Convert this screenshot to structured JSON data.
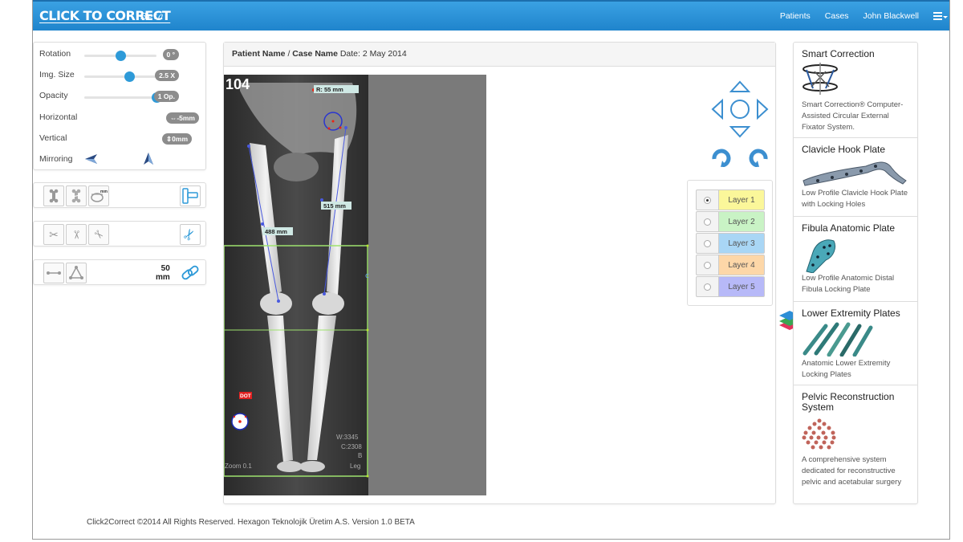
{
  "brand": {
    "name": "CLICK TO CORRECT",
    "tag": "Beta"
  },
  "nav": {
    "patients": "Patients",
    "cases": "Cases",
    "user": "John Blackwell"
  },
  "controls": {
    "rotation": {
      "label": "Rotation",
      "value": "0 °",
      "level": 0.5
    },
    "img_size": {
      "label": "Img. Size",
      "value": "2.5 X",
      "level": 0.62
    },
    "opacity": {
      "label": "Opacity",
      "value": "1 Op.",
      "level": 1.0
    },
    "horizontal": {
      "label": "Horizontal",
      "value": "⇔-5mm"
    },
    "vertical": {
      "label": "Vertical",
      "value": "⇕0mm"
    },
    "mirroring": {
      "label": "Mirroring"
    }
  },
  "toolbar3": {
    "distance_value": "50",
    "distance_unit": "mm"
  },
  "viewer": {
    "patient": "Patient Name",
    "sep": " / ",
    "case": "Case Name",
    "date_label": " Date:",
    "date": " 2 May 2014",
    "xray": {
      "number": "104",
      "radius": "R: 55 mm",
      "meas1": "488 mm",
      "meas2": "515 mm",
      "dot_label": "DOT",
      "info_w": "W:3345",
      "info_c": "C:2308",
      "info_b": "B",
      "info_leg": "Leg",
      "zoom": "Zoom 0.1"
    }
  },
  "layers": [
    {
      "label": "Layer 1",
      "color": "#fbf79a",
      "selected": true
    },
    {
      "label": "Layer 2",
      "color": "#c9f3c5",
      "selected": false
    },
    {
      "label": "Layer 3",
      "color": "#a9d6f5",
      "selected": false
    },
    {
      "label": "Layer 4",
      "color": "#fdd7a8",
      "selected": false
    },
    {
      "label": "Layer 5",
      "color": "#b7b9f8",
      "selected": false
    }
  ],
  "products": [
    {
      "title": "Smart Correction",
      "desc": "Smart Correction® Computer-Assisted Circular External Fixator System."
    },
    {
      "title": "Clavicle Hook Plate",
      "desc": "Low Profile Clavicle Hook Plate with Locking Holes"
    },
    {
      "title": "Fibula Anatomic Plate",
      "desc": "Low Profile Anatomic Distal Fibula Locking Plate"
    },
    {
      "title": "Lower Extremity Plates",
      "desc": "Anatomic Lower Extremity Locking Plates"
    },
    {
      "title": "Pelvic Reconstruction System",
      "desc": "A comprehensive system dedicated for reconstructive pelvic and acetabular surgery"
    }
  ],
  "footer": "Click2Correct ©2014 All Rights Reserved. Hexagon Teknolojik Üretim A.S. Version 1.0 BETA",
  "colors": {
    "navbar": "#2690d6",
    "accent": "#2e9ad8",
    "pill": "#8c8c8c"
  }
}
